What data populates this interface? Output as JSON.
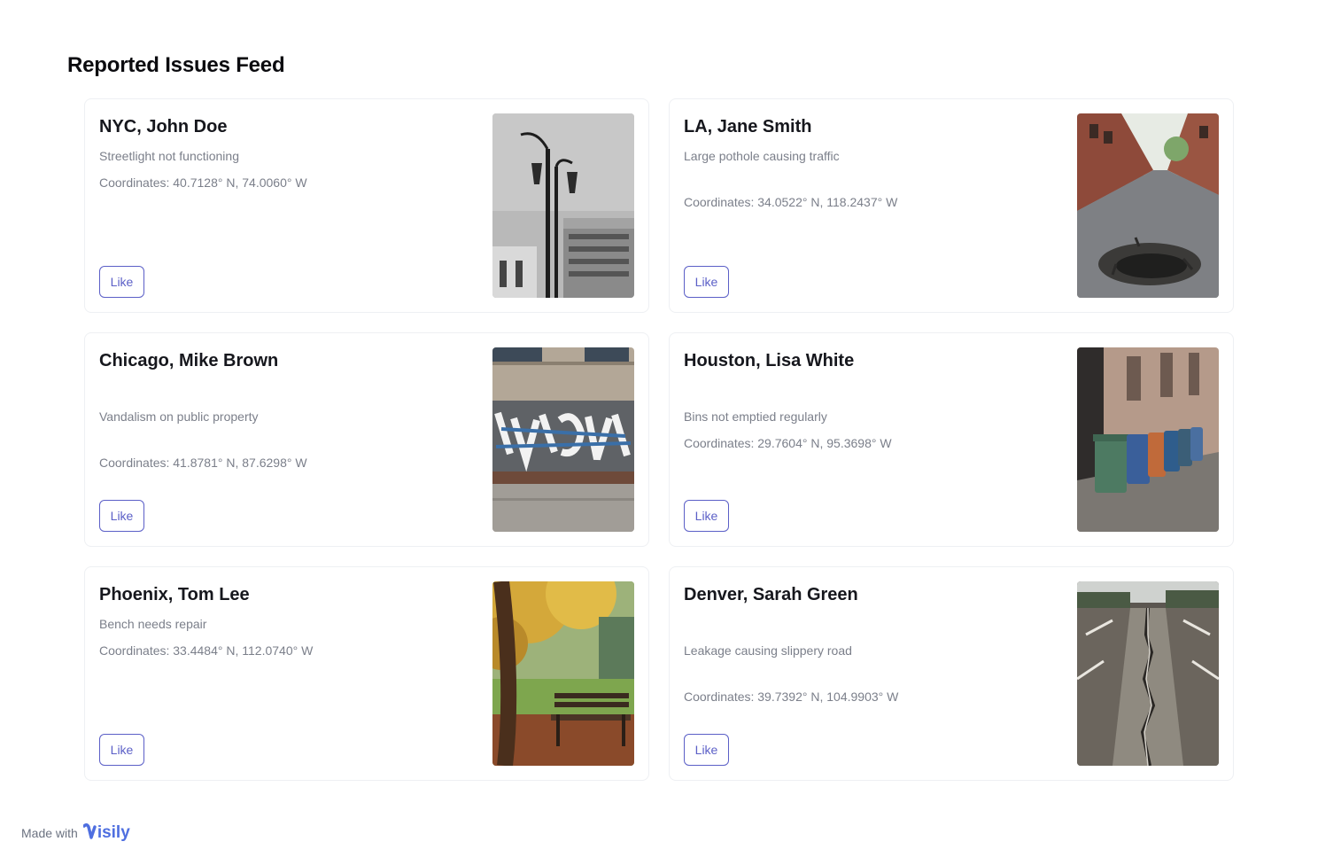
{
  "page": {
    "title": "Reported Issues Feed"
  },
  "issues": [
    {
      "title": "NYC, John Doe",
      "description": "Streetlight not functioning",
      "coordinates": "Coordinates: 40.7128° N, 74.0060° W",
      "like_label": "Like",
      "image": "streetlight-photo"
    },
    {
      "title": "LA, Jane Smith",
      "description": "Large pothole causing traffic",
      "coordinates": "Coordinates: 34.0522° N, 118.2437° W",
      "like_label": "Like",
      "image": "pothole-photo"
    },
    {
      "title": "Chicago, Mike Brown",
      "description": "Vandalism on public property",
      "coordinates": "Coordinates: 41.8781° N, 87.6298° W",
      "like_label": "Like",
      "image": "graffiti-photo"
    },
    {
      "title": "Houston, Lisa White",
      "description": "Bins not emptied regularly",
      "coordinates": "Coordinates: 29.7604° N, 95.3698° W",
      "like_label": "Like",
      "image": "trash-bins-photo"
    },
    {
      "title": "Phoenix, Tom Lee",
      "description": "Bench needs repair",
      "coordinates": "Coordinates: 33.4484° N, 112.0740° W",
      "like_label": "Like",
      "image": "park-bench-photo"
    },
    {
      "title": "Denver, Sarah Green",
      "description": "Leakage causing slippery road",
      "coordinates": "Coordinates: 39.7392° N, 104.9903° W",
      "like_label": "Like",
      "image": "cracked-road-photo"
    }
  ],
  "footer": {
    "made_with": "Made with",
    "brand": "isily"
  },
  "colors": {
    "accent": "#5b5fc7",
    "muted_text": "#7b7f8a",
    "brand": "#4f6fe0"
  }
}
